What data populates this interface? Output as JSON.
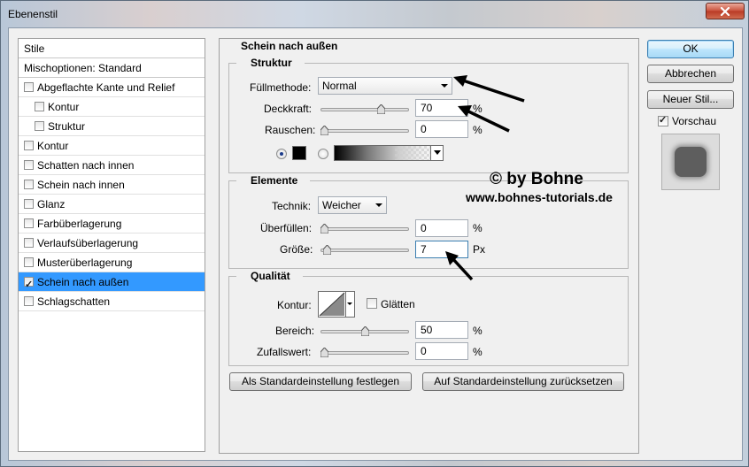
{
  "window": {
    "title": "Ebenenstil"
  },
  "style_list": {
    "header": "Stile",
    "blend_options": "Mischoptionen: Standard",
    "items": [
      {
        "label": "Abgeflachte Kante und Relief",
        "checked": false,
        "sub": false
      },
      {
        "label": "Kontur",
        "checked": false,
        "sub": true
      },
      {
        "label": "Struktur",
        "checked": false,
        "sub": true
      },
      {
        "label": "Kontur",
        "checked": false,
        "sub": false
      },
      {
        "label": "Schatten nach innen",
        "checked": false,
        "sub": false
      },
      {
        "label": "Schein nach innen",
        "checked": false,
        "sub": false
      },
      {
        "label": "Glanz",
        "checked": false,
        "sub": false
      },
      {
        "label": "Farbüberlagerung",
        "checked": false,
        "sub": false
      },
      {
        "label": "Verlaufsüberlagerung",
        "checked": false,
        "sub": false
      },
      {
        "label": "Musterüberlagerung",
        "checked": false,
        "sub": false
      },
      {
        "label": "Schein nach außen",
        "checked": true,
        "sub": false,
        "selected": true
      },
      {
        "label": "Schlagschatten",
        "checked": false,
        "sub": false
      }
    ]
  },
  "panel": {
    "title": "Schein nach außen",
    "struktur": {
      "label": "Struktur",
      "blend_mode_label": "Füllmethode:",
      "blend_mode_value": "Normal",
      "opacity_label": "Deckkraft:",
      "opacity_value": "70",
      "opacity_unit": "%",
      "noise_label": "Rauschen:",
      "noise_value": "0",
      "noise_unit": "%"
    },
    "elemente": {
      "label": "Elemente",
      "technique_label": "Technik:",
      "technique_value": "Weicher",
      "spread_label": "Überfüllen:",
      "spread_value": "0",
      "spread_unit": "%",
      "size_label": "Größe:",
      "size_value": "7",
      "size_unit": "Px"
    },
    "qualitaet": {
      "label": "Qualität",
      "contour_label": "Kontur:",
      "antialias_label": "Glätten",
      "range_label": "Bereich:",
      "range_value": "50",
      "range_unit": "%",
      "jitter_label": "Zufallswert:",
      "jitter_value": "0",
      "jitter_unit": "%"
    },
    "make_default_button": "Als Standardeinstellung festlegen",
    "reset_default_button": "Auf Standardeinstellung zurücksetzen"
  },
  "watermark": {
    "copyright": "© by Bohne",
    "url": "www.bohnes-tutorials.de"
  },
  "buttons": {
    "ok": "OK",
    "cancel": "Abbrechen",
    "new_style": "Neuer Stil...",
    "preview_label": "Vorschau",
    "preview_checked": true
  },
  "colors": {
    "selection": "#3399ff",
    "glow_color": "#000000"
  },
  "slider_levels": {
    "opacity": 0.7,
    "noise": 0,
    "spread": 0,
    "size": 0.03,
    "range": 0.5,
    "jitter": 0
  }
}
